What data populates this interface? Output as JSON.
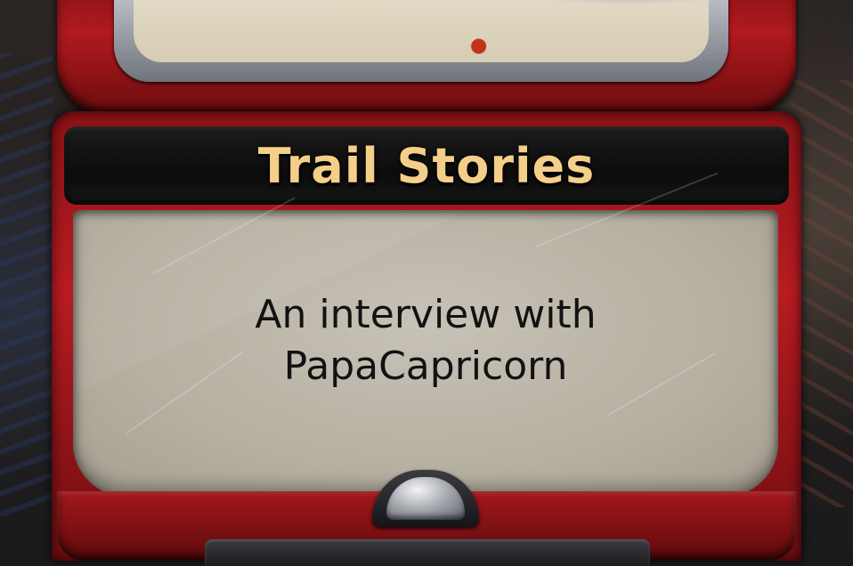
{
  "card": {
    "title": "Trail Stories",
    "description_lines": [
      "An interview with",
      "PapaCapricorn"
    ]
  },
  "colors": {
    "frame_red": "#b11a1e",
    "title_gold": "#f3cf8a",
    "title_bar": "#111111",
    "text_panel": "#bfbab0",
    "text": "#121212"
  }
}
